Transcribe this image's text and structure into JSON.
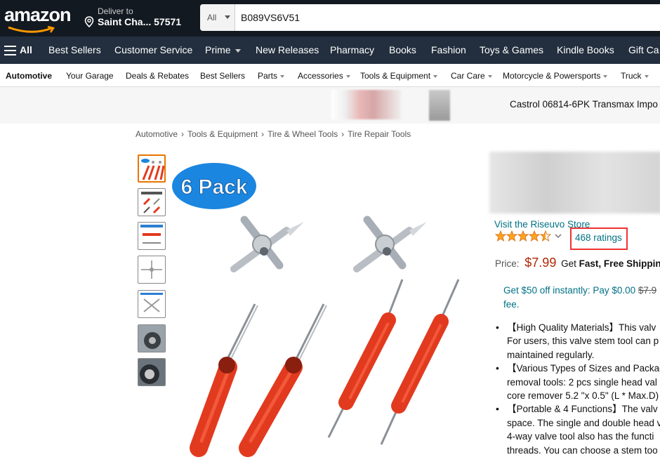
{
  "header": {
    "logo": "amazon",
    "deliver_line1": "Deliver to",
    "deliver_line2": "Saint Cha... 57571",
    "search_category": "All",
    "search_value": "B089VS6V51"
  },
  "navbar": {
    "all": "All",
    "items": [
      "Best Sellers",
      "Customer Service",
      "Prime",
      "New Releases",
      "Pharmacy",
      "Books",
      "Fashion",
      "Toys & Games",
      "Kindle Books",
      "Gift Ca"
    ]
  },
  "subnav": {
    "items": [
      "Automotive",
      "Your Garage",
      "Deals & Rebates",
      "Best Sellers",
      "Parts",
      "Accessories",
      "Tools & Equipment",
      "Car Care",
      "Motorcycle & Powersports",
      "Truck"
    ]
  },
  "banner": {
    "text": "Castrol 06814-6PK Transmax Impo"
  },
  "breadcrumb": [
    "Automotive",
    "Tools & Equipment",
    "Tire & Wheel Tools",
    "Tire Repair Tools"
  ],
  "product": {
    "image_badge": "6 Pack",
    "store_link": "Visit the Riseuvo Store",
    "rating": 4.5,
    "ratings_count": "468 ratings",
    "price_label": "Price:",
    "price": "$7.99",
    "shipping_get": "Get",
    "shipping_bold": "Fast, Free Shipping",
    "offer_line1": "Get $50 off instantly: Pay $0.00",
    "offer_strike": "$7.9",
    "offer_line2": "fee.",
    "bullets": [
      [
        "【High Quality Materials】This valv",
        "For users, this valve stem tool can p",
        "maintained regularly."
      ],
      [
        "【Various Types of Sizes and Packag",
        "removal tools: 2 pcs single head val",
        "core remover 5.2 \"x 0.5\" (L * Max.D)"
      ],
      [
        "【Portable & 4 Functions】The valv",
        "space. The single and double head v",
        "4-way valve tool also has the functi",
        "threads. You can choose a stem too"
      ]
    ]
  },
  "colors": {
    "header_bg": "#131921",
    "nav_bg": "#232f3e",
    "price": "#b12704",
    "link": "#007185",
    "star": "#ffa41c",
    "highlight_box": "#ee3333",
    "tool_red": "#e23a1e"
  }
}
